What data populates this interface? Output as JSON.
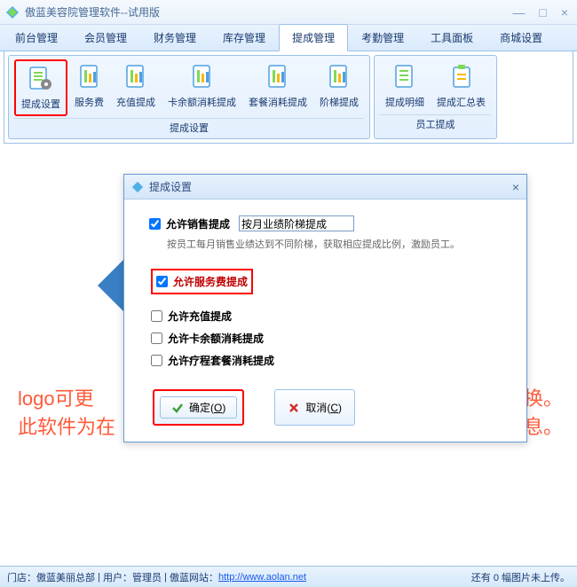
{
  "window": {
    "title": "傲蓝美容院管理软件--试用版"
  },
  "menu": {
    "items": [
      "前台管理",
      "会员管理",
      "财务管理",
      "库存管理",
      "提成管理",
      "考勤管理",
      "工具面板",
      "商城设置"
    ],
    "activeIndex": 4
  },
  "ribbon": {
    "group1": {
      "title": "提成设置",
      "items": [
        "提成设置",
        "服务费",
        "充值提成",
        "卡余额消耗提成",
        "套餐消耗提成",
        "阶梯提成"
      ]
    },
    "group2": {
      "title": "员工提成",
      "items": [
        "提成明细",
        "提成汇总表"
      ]
    }
  },
  "bgText1": "logo可更",
  "bgText1b": "换。",
  "bgText2": "此软件为在",
  "bgText2b": "息。",
  "dialog": {
    "title": "提成设置",
    "allowSales": "允许销售提成",
    "salesMode": "按月业绩阶梯提成",
    "hint": "按员工每月销售业绩达到不同阶梯，获取相应提成比例，激励员工。",
    "allowService": "允许服务费提成",
    "allowRecharge": "允许充值提成",
    "allowBalance": "允许卡余额消耗提成",
    "allowPackage": "允许疗程套餐消耗提成",
    "ok": "确定(O)",
    "cancel": "取消(C)"
  },
  "status": {
    "store": "门店：傲蓝美丽总部",
    "user": "用户：管理员",
    "siteLabel": "傲蓝网站：",
    "siteUrl": "http://www.aolan.net",
    "right": "还有 0 幅图片未上传。"
  }
}
